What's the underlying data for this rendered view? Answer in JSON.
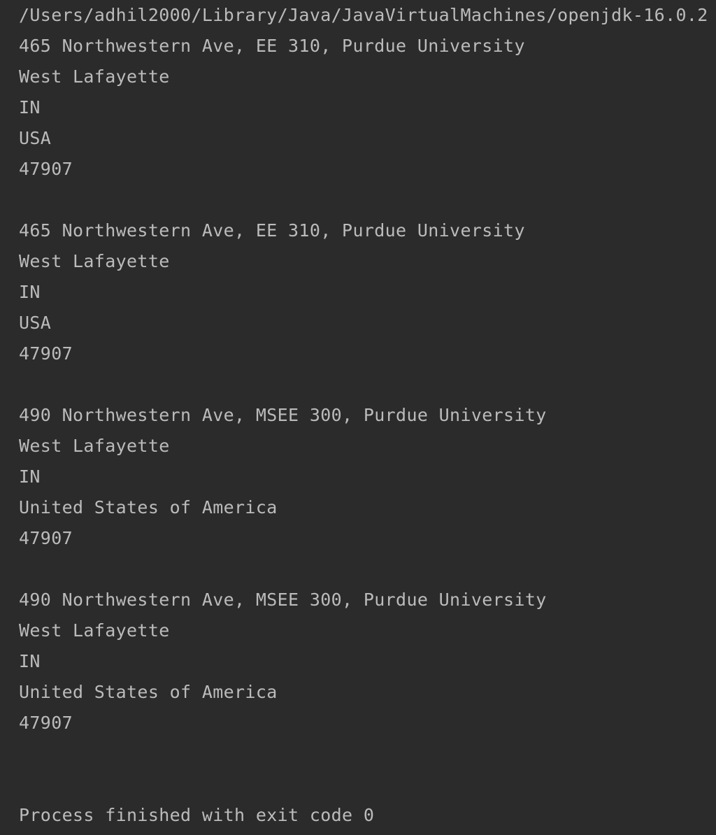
{
  "console": {
    "command_line": "/Users/adhil2000/Library/Java/JavaVirtualMachines/openjdk-16.0.2",
    "records": [
      {
        "street": "465 Northwestern Ave, EE 310, Purdue University",
        "city": "West Lafayette",
        "state": "IN",
        "country": "USA",
        "zip": "47907"
      },
      {
        "street": "465 Northwestern Ave, EE 310, Purdue University",
        "city": "West Lafayette",
        "state": "IN",
        "country": "USA",
        "zip": "47907"
      },
      {
        "street": "490 Northwestern Ave, MSEE 300, Purdue University",
        "city": "West Lafayette",
        "state": "IN",
        "country": "United States of America",
        "zip": "47907"
      },
      {
        "street": "490 Northwestern Ave, MSEE 300, Purdue University",
        "city": "West Lafayette",
        "state": "IN",
        "country": "United States of America",
        "zip": "47907"
      }
    ],
    "exit_message": "Process finished with exit code 0"
  }
}
